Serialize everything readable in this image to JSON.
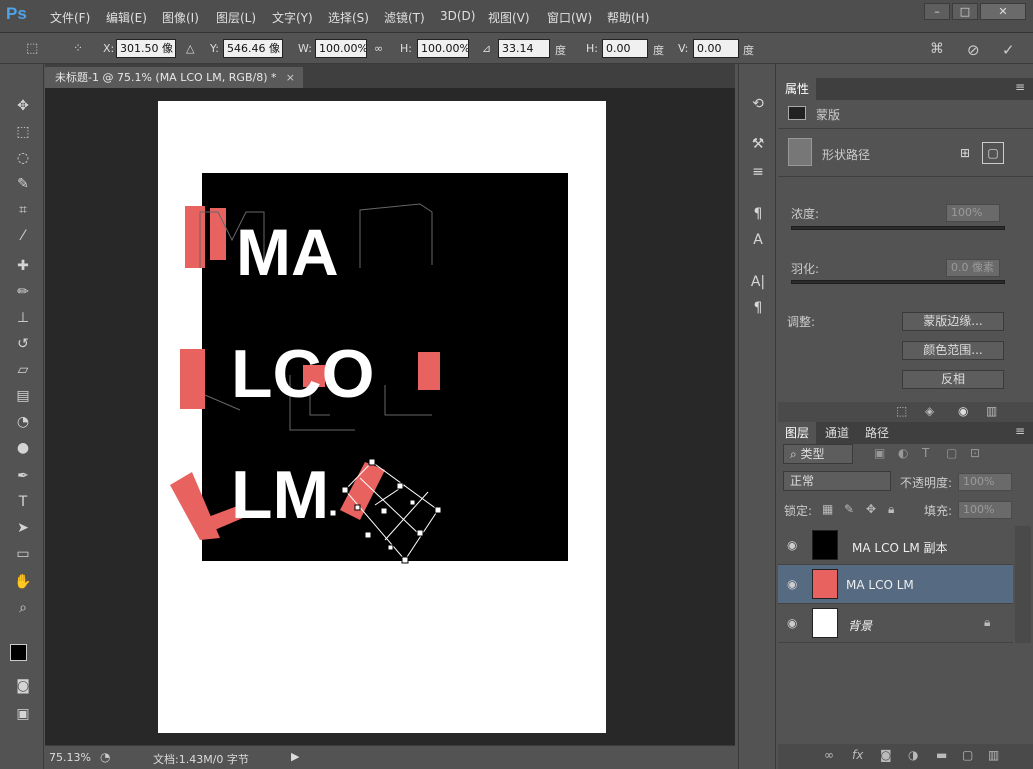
{
  "app": {
    "logo": "Ps"
  },
  "menu": [
    "文件(F)",
    "编辑(E)",
    "图像(I)",
    "图层(L)",
    "文字(Y)",
    "选择(S)",
    "滤镜(T)",
    "3D(D)",
    "视图(V)",
    "窗口(W)",
    "帮助(H)"
  ],
  "window_controls": {
    "minimize": "–",
    "maximize": "□",
    "close": "✕"
  },
  "options": {
    "x_label": "X:",
    "x_value": "301.50 像",
    "y_label": "Y:",
    "y_value": "546.46 像",
    "w_label": "W:",
    "w_value": "100.00%",
    "h_label": "H:",
    "h_value": "100.00%",
    "angle_value": "33.14",
    "angle_unit": "度",
    "hskew_label": "H:",
    "hskew_value": "0.00",
    "hskew_unit": "度",
    "vskew_label": "V:",
    "vskew_value": "0.00",
    "vskew_unit": "度"
  },
  "document": {
    "tab_title": "未标题-1 @ 75.1% (MA LCO LM, RGB/8) *",
    "canvas_text": {
      "line1": "MA",
      "line2": "LCO",
      "line3": "LM"
    },
    "accent_color": "#e8625f"
  },
  "status": {
    "zoom": "75.13%",
    "doc_info": "文档:1.43M/0 字节"
  },
  "properties": {
    "tab": "属性",
    "mask_label": "蒙版",
    "shape_path_label": "形状路径",
    "density_label": "浓度:",
    "density_value": "100%",
    "feather_label": "羽化:",
    "feather_value": "0.0 像素",
    "adjust_label": "调整:",
    "buttons": [
      "蒙版边缘...",
      "颜色范围...",
      "反相"
    ]
  },
  "layers_panel": {
    "tabs": [
      "图层",
      "通道",
      "路径"
    ],
    "filter_kind": "类型",
    "blend_mode": "正常",
    "opacity_label": "不透明度:",
    "opacity_value": "100%",
    "lock_label": "锁定:",
    "fill_label": "填充:",
    "fill_value": "100%",
    "layers": [
      {
        "name": "MA LCO LM 副本",
        "selected": false
      },
      {
        "name": "MA LCO LM",
        "selected": true
      },
      {
        "name": "背景",
        "selected": false
      }
    ]
  },
  "colors": {
    "selection": "#566a82",
    "panel": "#535353"
  }
}
